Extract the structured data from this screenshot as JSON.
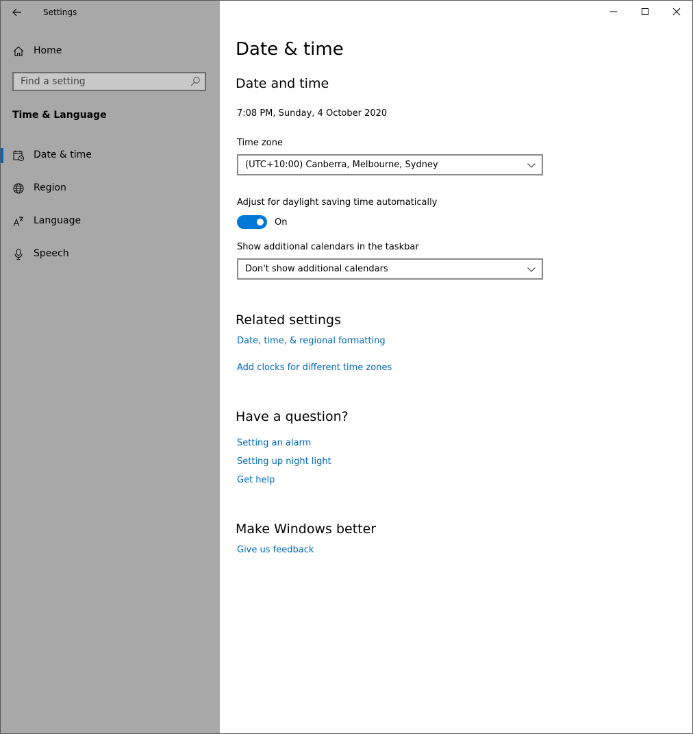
{
  "window": {
    "title": "Settings",
    "controls": {
      "minimize_icon": "minimize-icon",
      "maximize_icon": "maximize-icon",
      "close_icon": "close-icon"
    }
  },
  "sidebar": {
    "home_label": "Home",
    "search": {
      "placeholder": "Find a setting",
      "value": ""
    },
    "section_label": "Time & Language",
    "items": [
      {
        "label": "Date & time",
        "icon": "calendar-clock-icon",
        "selected": true
      },
      {
        "label": "Region",
        "icon": "globe-icon",
        "selected": false
      },
      {
        "label": "Language",
        "icon": "language-icon",
        "selected": false
      },
      {
        "label": "Speech",
        "icon": "microphone-icon",
        "selected": false
      }
    ]
  },
  "main": {
    "page_title": "Date & time",
    "date_time_section": {
      "heading": "Date and time",
      "current_datetime": "7:08 PM, Sunday, 4 October 2020",
      "time_zone_label": "Time zone",
      "time_zone_value": "(UTC+10:00) Canberra, Melbourne, Sydney",
      "dst_label": "Adjust for daylight saving time automatically",
      "dst_state": "On",
      "calendars_label": "Show additional calendars in the taskbar",
      "calendars_value": "Don't show additional calendars"
    },
    "related_settings": {
      "heading": "Related settings",
      "links": [
        "Date, time, & regional formatting",
        "Add clocks for different time zones"
      ]
    },
    "have_a_question": {
      "heading": "Have a question?",
      "links": [
        "Setting an alarm",
        "Setting up night light",
        "Get help"
      ]
    },
    "make_windows_better": {
      "heading": "Make Windows better",
      "links": [
        "Give us feedback"
      ]
    }
  },
  "colors": {
    "sidebar_bg": "#a8a8a8",
    "accent": "#0078d7",
    "link": "#0067b8"
  }
}
